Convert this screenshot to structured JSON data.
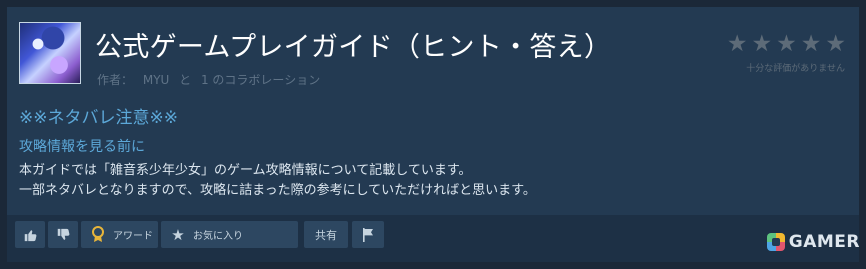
{
  "guide": {
    "title": "公式ゲームプレイガイド（ヒント・答え）",
    "author_prefix": "作者：",
    "author_name": "MYU",
    "author_and": "と",
    "collab_text": "1 のコラボレーション",
    "rating_stars": 5,
    "rating_note": "十分な評価がありません"
  },
  "content": {
    "spoiler_warning": "※※ネタバレ注意※※",
    "pre_guide_heading": "攻略情報を見る前に",
    "line1": "本ガイドでは「雑音系少年少女」のゲーム攻略情報について記載しています。",
    "line2": "一部ネタバレとなりますので、攻略に詰まった際の参考にしていただければと思います。"
  },
  "actions": {
    "award_label": "アワード",
    "favorite_label": "お気に入り",
    "share_label": "共有"
  },
  "watermark": {
    "text": "GAMER"
  }
}
